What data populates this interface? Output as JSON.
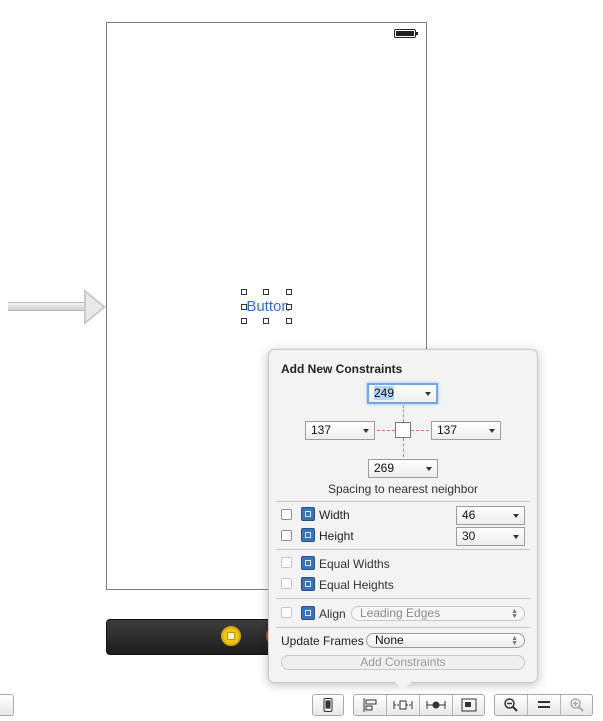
{
  "canvas": {
    "button_label": "Button"
  },
  "popover": {
    "title": "Add New Constraints",
    "spacing": {
      "top": "249",
      "left": "137",
      "right": "137",
      "bottom": "269",
      "caption": "Spacing to nearest neighbor"
    },
    "width": {
      "label": "Width",
      "value": "46"
    },
    "height": {
      "label": "Height",
      "value": "30"
    },
    "equal_widths": {
      "label": "Equal Widths"
    },
    "equal_heights": {
      "label": "Equal Heights"
    },
    "align": {
      "label": "Align",
      "value": "Leading Edges"
    },
    "update_frames": {
      "label": "Update Frames",
      "value": "None"
    },
    "add_button": "Add Constraints"
  },
  "colors": {
    "accent": "#3b73b9",
    "constraint_line": "#e0766a",
    "button_text": "#2f6fd6"
  },
  "toolbar": {
    "icons": [
      "device-icon",
      "align-icon",
      "pin-icon",
      "resolve-icon",
      "resize-icon",
      "zoom-out-icon",
      "zoom-reset-icon",
      "zoom-in-icon"
    ]
  }
}
